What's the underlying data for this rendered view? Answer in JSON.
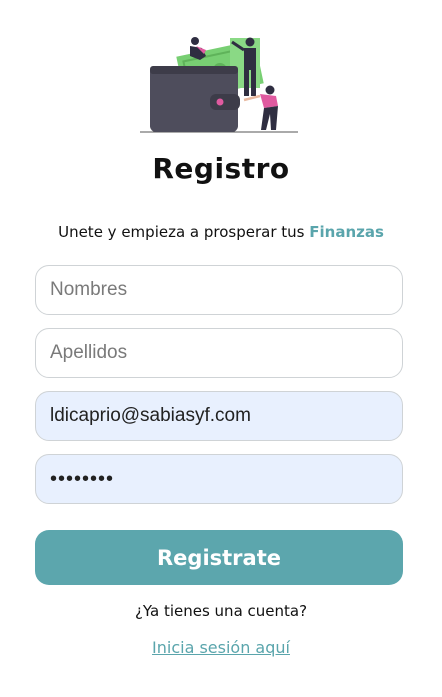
{
  "header": {
    "title": "Registro",
    "subtitle_prefix": "Unete y empieza a prosperar tus ",
    "subtitle_accent": "Finanzas"
  },
  "illustration": {
    "icon": "wallet-money-illustration-icon"
  },
  "form": {
    "nombres": {
      "placeholder": "Nombres",
      "value": ""
    },
    "apellidos": {
      "placeholder": "Apellidos",
      "value": ""
    },
    "email": {
      "placeholder": "",
      "value": "ldicaprio@sabiasyf.com"
    },
    "password": {
      "placeholder": "",
      "value": "••••••••"
    },
    "submit_label": "Registrate"
  },
  "footer": {
    "question": "¿Ya tienes una cuenta?",
    "login_link": "Inicia sesión aquí"
  },
  "colors": {
    "accent": "#5ca6ad",
    "autofill_bg": "#e8f0fe",
    "money_green": "#7ed17a",
    "wallet": "#4e4d5c",
    "pink": "#e05aa0"
  }
}
